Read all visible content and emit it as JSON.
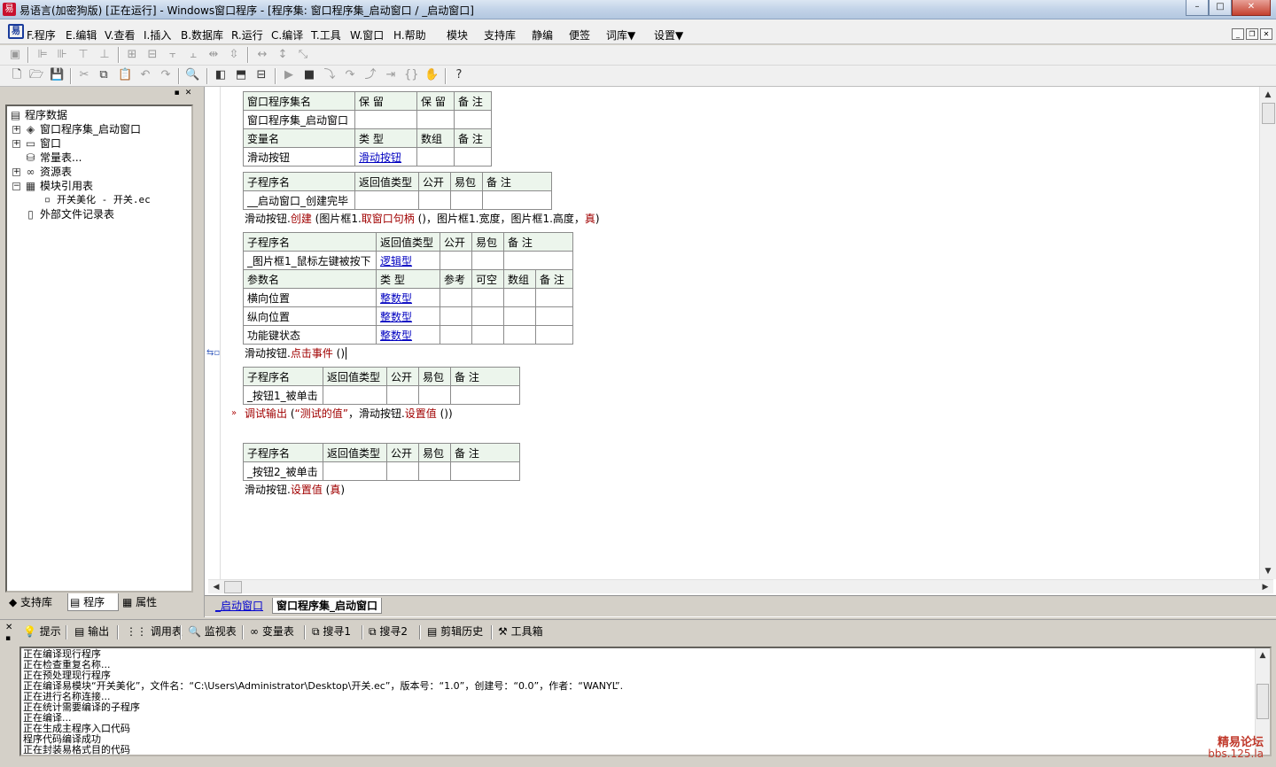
{
  "titlebar": {
    "title": "易语言(加密狗版) [正在运行] - Windows窗口程序 - [程序集: 窗口程序集_启动窗口 / _启动窗口]",
    "min": "–",
    "max": "□",
    "close": "✕"
  },
  "menu": {
    "items": [
      "F.程序",
      "E.编辑",
      "V.查看",
      "I.插入",
      "B.数据库",
      "R.运行",
      "C.编译",
      "T.工具",
      "W.窗口",
      "H.帮助",
      "模块",
      "支持库",
      "静编",
      "便签",
      "词库▼",
      "设置▼"
    ],
    "mdi": {
      "min": "_",
      "restore": "❐",
      "close": "✕"
    }
  },
  "panel_ctrl": {
    "pin": "▪",
    "close": "✕"
  },
  "tree": {
    "root": "程序数据",
    "items": [
      "窗口程序集_启动窗口",
      "窗口",
      "常量表...",
      "资源表",
      "模块引用表",
      "开关美化 - 开关.ec",
      "外部文件记录表"
    ]
  },
  "left_tabs": {
    "support": "支持库",
    "program": "程序",
    "property": "属性"
  },
  "code": {
    "t1": {
      "h1": [
        "窗口程序集名",
        "保 留",
        "保 留",
        "备 注"
      ],
      "r1": [
        "窗口程序集_启动窗口",
        "",
        "",
        ""
      ],
      "h2": [
        "变量名",
        "类 型",
        "数组",
        "备 注"
      ],
      "r2": [
        "滑动按钮",
        "滑动按钮",
        "",
        ""
      ]
    },
    "t2": {
      "h": [
        "子程序名",
        "返回值类型",
        "公开",
        "易包",
        "备 注"
      ],
      "r": [
        "__启动窗口_创建完毕",
        "",
        "",
        "",
        ""
      ]
    },
    "line1": {
      "obj": "滑动按钮.",
      "method": "创建",
      "args": " (图片框1.",
      "m2": "取窗口句柄",
      "args2": " ()，图片框1.宽度，图片框1.高度，",
      "val": "真",
      "end": ")"
    },
    "t3": {
      "h": [
        "子程序名",
        "返回值类型",
        "公开",
        "易包",
        "备 注"
      ],
      "r": [
        "_图片框1_鼠标左键被按下",
        "逻辑型",
        "",
        "",
        ""
      ],
      "ph": [
        "参数名",
        "类 型",
        "参考",
        "可空",
        "数组",
        "备 注"
      ],
      "params": [
        [
          "横向位置",
          "整数型"
        ],
        [
          "纵向位置",
          "整数型"
        ],
        [
          "功能键状态",
          "整数型"
        ]
      ]
    },
    "line2": {
      "obj": "滑动按钮.",
      "method": "点击事件",
      "end": " ()"
    },
    "t4": {
      "h": [
        "子程序名",
        "返回值类型",
        "公开",
        "易包",
        "备 注"
      ],
      "r": [
        "_按钮1_被单击",
        "",
        "",
        "",
        ""
      ]
    },
    "line3": {
      "cmd": "调试输出",
      "p1": " (",
      "str": "“测试的值”",
      "p2": "，滑动按钮.",
      "method": "设置值",
      "end": " ())"
    },
    "t5": {
      "h": [
        "子程序名",
        "返回值类型",
        "公开",
        "易包",
        "备 注"
      ],
      "r": [
        "_按钮2_被单击",
        "",
        "",
        "",
        ""
      ]
    },
    "line4": {
      "obj": "滑动按钮.",
      "method": "设置值",
      "args": " (",
      "val": "真",
      "end": ")"
    }
  },
  "editor_tabs": {
    "tab1": "_启动窗口",
    "tab2": "窗口程序集_启动窗口"
  },
  "output_tabs": [
    "提示",
    "输出",
    "调用表",
    "监视表",
    "变量表",
    "搜寻1",
    "搜寻2",
    "剪辑历史",
    "工具箱"
  ],
  "output_lines": [
    "正在编译现行程序",
    "正在检查重复名称...",
    "正在预处理现行程序",
    "正在编译易模块“开关美化”，文件名：“C:\\Users\\Administrator\\Desktop\\开关.ec”，版本号：“1.0”，创建号：“0.0”，作者：“WANYL”.",
    "正在进行名称连接...",
    "正在统计需要编译的子程序",
    "正在编译...",
    "正在生成主程序入口代码",
    "程序代码编译成功",
    "正在封装易格式目的代码"
  ],
  "watermark": {
    "line1": "精易论坛",
    "line2": "bbs.125.la"
  }
}
